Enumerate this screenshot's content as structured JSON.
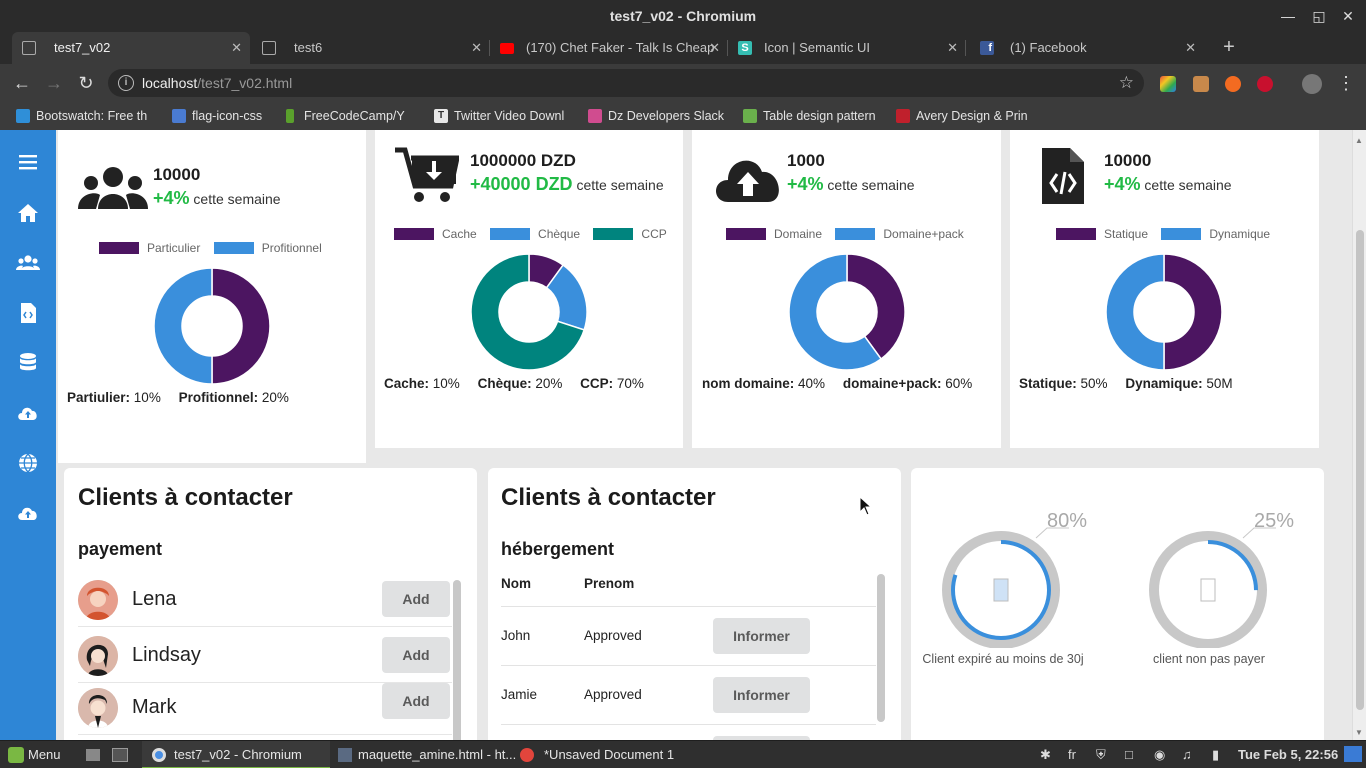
{
  "window": {
    "title": "test7_v02 - Chromium"
  },
  "tabs": [
    {
      "label": "test7_v02",
      "active": true,
      "favicon": "page-icon",
      "color": "#9a9a9a"
    },
    {
      "label": "test6",
      "active": false,
      "favicon": "page-icon",
      "color": "#9a9a9a"
    },
    {
      "label": "(170) Chet Faker - Talk Is Cheap",
      "active": false,
      "favicon": "youtube-icon",
      "color": "#ff0000"
    },
    {
      "label": "Icon | Semantic UI",
      "active": false,
      "favicon": "semantic-ui-icon",
      "color": "#35bdb2"
    },
    {
      "label": "(1) Facebook",
      "active": false,
      "favicon": "facebook-icon",
      "color": "#3b5998"
    }
  ],
  "toolbar": {
    "url_host": "localhost",
    "url_path": "/test7_v02.html"
  },
  "bookmarks": [
    {
      "label": "Bootswatch: Free th",
      "icon": "bootswatch-icon",
      "color": "#2f8fd8"
    },
    {
      "label": "flag-icon-css",
      "icon": "github-icon",
      "color": "#4a7bd1"
    },
    {
      "label": "FreeCodeCamp/Y",
      "icon": "freecodecamp-icon",
      "color": "#5aa02c"
    },
    {
      "label": "Twitter Video Downl",
      "icon": "twitter-video-icon",
      "color": "#e8e8e8"
    },
    {
      "label": "Dz Developers Slack",
      "icon": "slack-icon",
      "color": "#d04c8f"
    },
    {
      "label": "Table design pattern",
      "icon": "document-icon",
      "color": "#6ab04c"
    },
    {
      "label": "Avery Design & Prin",
      "icon": "avery-icon",
      "color": "#c0202c"
    }
  ],
  "colors": {
    "purple": "#4c1561",
    "blue": "#3a8fdc",
    "teal": "#00847e",
    "sidebar": "#2e86d6",
    "green": "#21ba45",
    "grey": "#c8c8c8"
  },
  "stats": [
    {
      "icon": "users-icon",
      "value": "10000",
      "gain": "+4%",
      "gain_label": "cette semaine",
      "legend": [
        {
          "label": "Particulier",
          "color": "#4c1561"
        },
        {
          "label": "Profitionnel",
          "color": "#3a8fdc"
        }
      ],
      "donut": [
        {
          "value": 50,
          "color": "#4c1561"
        },
        {
          "value": 50,
          "color": "#3a8fdc"
        }
      ],
      "footer": [
        {
          "label": "Partiulier:",
          "value": "10%"
        },
        {
          "label": "Profitionnel:",
          "value": "20%"
        }
      ]
    },
    {
      "icon": "cart-download-icon",
      "value": "1000000 DZD",
      "gain": "+40000 DZD",
      "gain_label": "cette semaine",
      "legend": [
        {
          "label": "Cache",
          "color": "#4c1561"
        },
        {
          "label": "Chèque",
          "color": "#3a8fdc"
        },
        {
          "label": "CCP",
          "color": "#00847e"
        }
      ],
      "donut": [
        {
          "value": 10,
          "color": "#4c1561"
        },
        {
          "value": 20,
          "color": "#3a8fdc"
        },
        {
          "value": 70,
          "color": "#00847e"
        }
      ],
      "footer": [
        {
          "label": "Cache:",
          "value": "10%"
        },
        {
          "label": "Chèque:",
          "value": "20%"
        },
        {
          "label": "CCP:",
          "value": "70%"
        }
      ]
    },
    {
      "icon": "cloud-upload-icon",
      "value": "1000",
      "gain": "+4%",
      "gain_label": "cette semaine",
      "legend": [
        {
          "label": "Domaine",
          "color": "#4c1561"
        },
        {
          "label": "Domaine+pack",
          "color": "#3a8fdc"
        }
      ],
      "donut": [
        {
          "value": 40,
          "color": "#4c1561"
        },
        {
          "value": 60,
          "color": "#3a8fdc"
        }
      ],
      "footer": [
        {
          "label": "nom domaine:",
          "value": "40%"
        },
        {
          "label": "domaine+pack:",
          "value": "60%"
        }
      ]
    },
    {
      "icon": "code-file-icon",
      "value": "10000",
      "gain": "+4%",
      "gain_label": "cette semaine",
      "legend": [
        {
          "label": "Statique",
          "color": "#4c1561"
        },
        {
          "label": "Dynamique",
          "color": "#3a8fdc"
        }
      ],
      "donut": [
        {
          "value": 50,
          "color": "#4c1561"
        },
        {
          "value": 50,
          "color": "#3a8fdc"
        }
      ],
      "footer": [
        {
          "label": "Statique:",
          "value": "50%"
        },
        {
          "label": "Dynamique:",
          "value": "50M"
        }
      ]
    }
  ],
  "clients_payment": {
    "title": "Clients à contacter",
    "subtitle": "payement",
    "people": [
      {
        "name": "Lena",
        "button": "Add"
      },
      {
        "name": "Lindsay",
        "button": "Add"
      },
      {
        "name": "Mark",
        "button": "Add"
      }
    ]
  },
  "clients_hosting": {
    "title": "Clients à contacter",
    "subtitle": "hébergement",
    "columns": [
      "Nom",
      "Prenom"
    ],
    "rows": [
      {
        "nom": "John",
        "prenom": "Approved",
        "button": "Informer"
      },
      {
        "nom": "Jamie",
        "prenom": "Approved",
        "button": "Informer"
      }
    ]
  },
  "progress": [
    {
      "percent_label": "80%",
      "fraction": 0.8,
      "caption": "Client expiré au moins de 30j"
    },
    {
      "percent_label": "25%",
      "fraction": 0.25,
      "caption": "client non pas payer"
    }
  ],
  "taskbar": {
    "menu_label": "Menu",
    "windows": [
      {
        "label": "test7_v02 - Chromium",
        "active": true
      },
      {
        "label": "maquette_amine.html - ht...",
        "active": false
      },
      {
        "label": "*Unsaved Document 1",
        "active": false
      }
    ],
    "keyboard_layout": "fr",
    "clock": "Tue Feb  5, 22:56"
  }
}
